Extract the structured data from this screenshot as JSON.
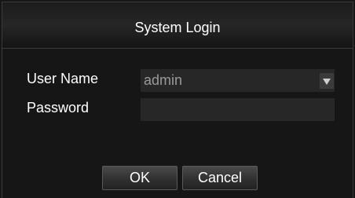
{
  "dialog": {
    "title": "System Login",
    "fields": {
      "username_label": "User Name",
      "username_value": "admin",
      "password_label": "Password",
      "password_value": ""
    },
    "buttons": {
      "ok_label": "OK",
      "cancel_label": "Cancel"
    }
  },
  "icons": {
    "dropdown": "chevron-down-icon"
  },
  "colors": {
    "background": "#161616",
    "field_background": "#272727",
    "text": "#ffffff",
    "muted_text": "#9a9a9a"
  }
}
